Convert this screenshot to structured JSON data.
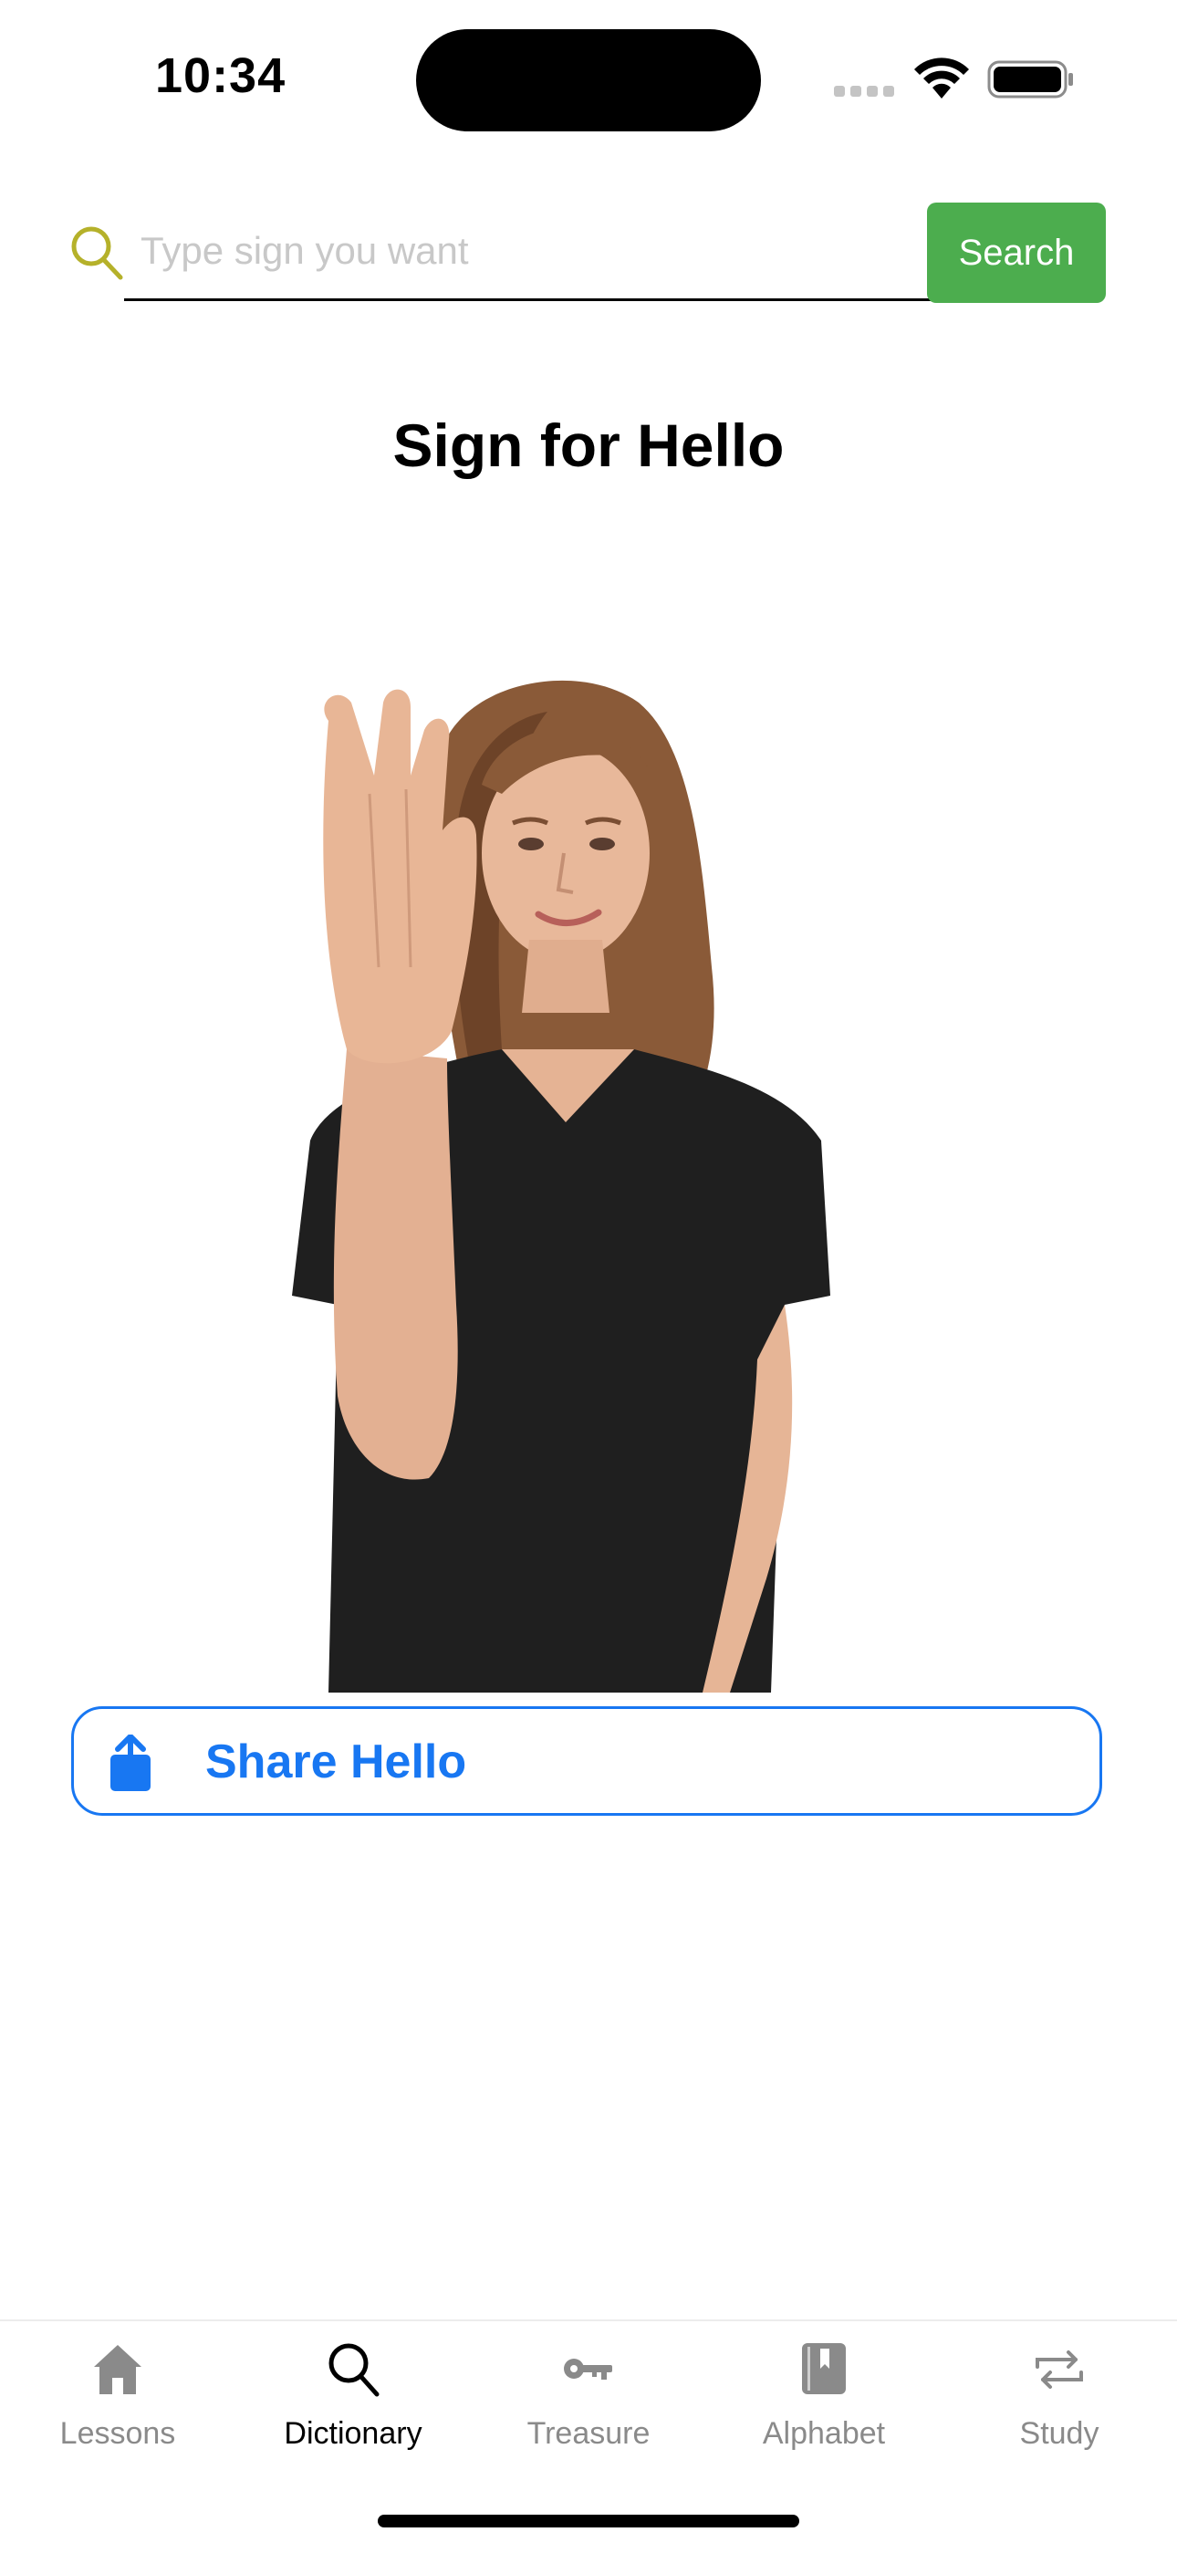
{
  "status_bar": {
    "time": "10:34"
  },
  "search": {
    "placeholder": "Type sign you want",
    "value": "",
    "button_label": "Search"
  },
  "page": {
    "title": "Sign for Hello"
  },
  "share": {
    "label": "Share Hello"
  },
  "colors": {
    "search_button": "#4cad4e",
    "accent_blue": "#1877f2",
    "search_icon": "#b5b12a",
    "tab_inactive": "#8a8a8a"
  },
  "tab_bar": {
    "active_index": 1,
    "tabs": [
      {
        "label": "Lessons",
        "icon": "house-icon"
      },
      {
        "label": "Dictionary",
        "icon": "magnifying-glass-icon"
      },
      {
        "label": "Treasure",
        "icon": "key-icon"
      },
      {
        "label": "Alphabet",
        "icon": "book-icon"
      },
      {
        "label": "Study",
        "icon": "repeat-arrows-icon"
      }
    ]
  }
}
